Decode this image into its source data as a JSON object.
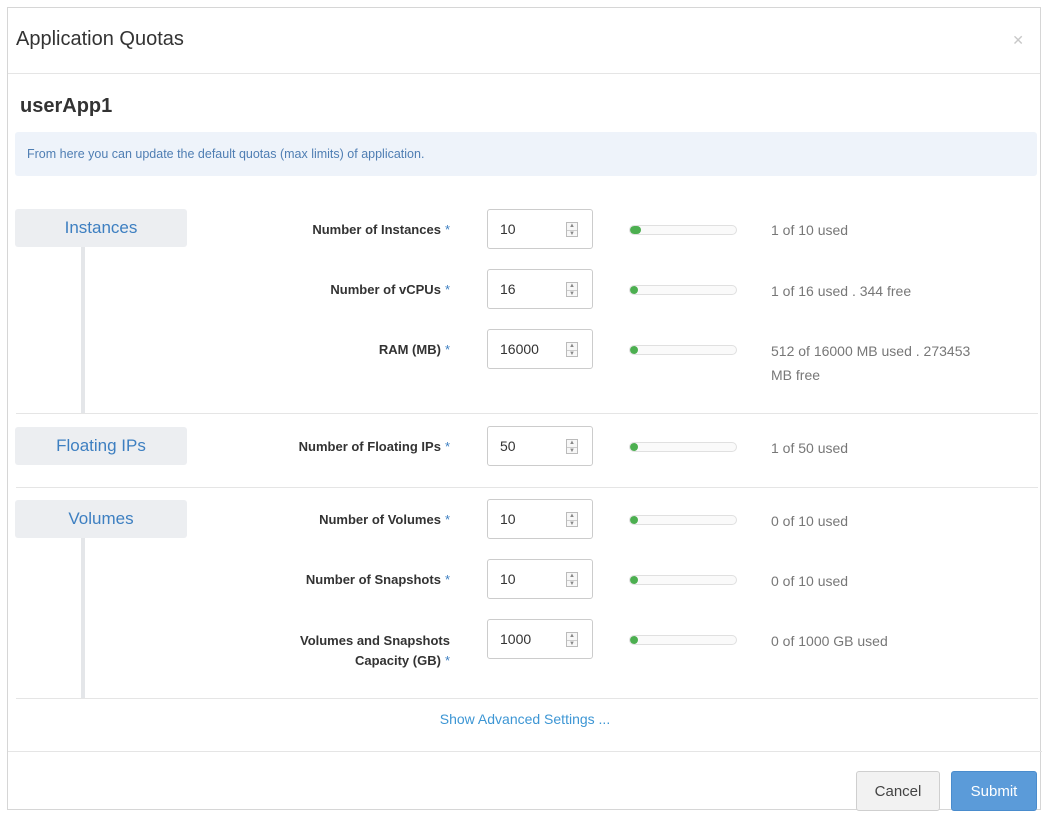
{
  "dialog": {
    "title": "Application Quotas",
    "close_icon": "close-icon",
    "app_name": "userApp1",
    "info": "From here you can update the default quotas (max limits) of application."
  },
  "sections": {
    "instances": {
      "label": "Instances",
      "fields": [
        {
          "label": "Number of Instances",
          "required": "*",
          "value": "10",
          "usage_fraction": 0.1,
          "usage": "1 of 10 used"
        },
        {
          "label": "Number of vCPUs",
          "required": "*",
          "value": "16",
          "usage_fraction": 0.0625,
          "usage": "1 of 16 used . 344 free"
        },
        {
          "label": "RAM (MB)",
          "required": "*",
          "value": "16000",
          "usage_fraction": 0.032,
          "usage_line1": "512 of 16000 MB used . 273453",
          "usage_line2": "MB free"
        }
      ]
    },
    "floating_ips": {
      "label": "Floating IPs",
      "fields": [
        {
          "label": "Number of Floating IPs",
          "required": "*",
          "value": "50",
          "usage_fraction": 0.02,
          "usage": "1 of 50 used"
        }
      ]
    },
    "volumes": {
      "label": "Volumes",
      "fields": [
        {
          "label": "Number of Volumes",
          "required": "*",
          "value": "10",
          "usage_fraction": 0.0,
          "usage": "0 of 10 used"
        },
        {
          "label": "Number of Snapshots",
          "required": "*",
          "value": "10",
          "usage_fraction": 0.0,
          "usage": "0 of 10 used"
        },
        {
          "label_line1": "Volumes and Snapshots",
          "label_line2": "Capacity (GB)",
          "required": "*",
          "value": "1000",
          "usage_fraction": 0.0,
          "usage": "0 of 1000 GB used"
        }
      ]
    }
  },
  "advanced_link": "Show Advanced Settings ...",
  "buttons": {
    "cancel": "Cancel",
    "submit": "Submit"
  },
  "colors": {
    "accent": "#3d7fc1",
    "progress": "#4caf50",
    "submit": "#5b9bd9"
  }
}
